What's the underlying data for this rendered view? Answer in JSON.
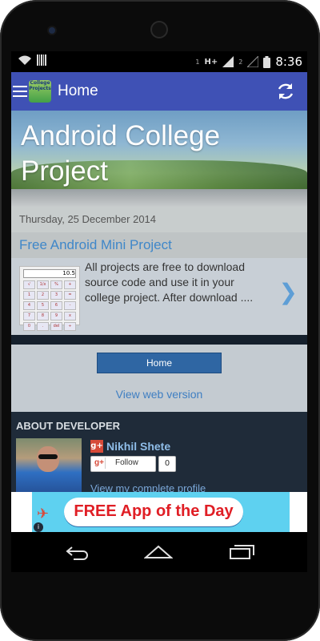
{
  "status_bar": {
    "time": "8:36",
    "signal_label_1": "H+",
    "sim_1": "1",
    "sim_2": "2",
    "icons": [
      "wifi-icon",
      "barcode-icon",
      "signal-icon",
      "signal-icon",
      "battery-icon"
    ]
  },
  "app_bar": {
    "title": "Home",
    "logo_text": "College Projects",
    "colors": {
      "background": "#3f51b5"
    }
  },
  "hero": {
    "title": "Android College Project"
  },
  "post": {
    "date": "Thursday, 25 December 2014",
    "title": "Free Android Mini Project",
    "excerpt": "All projects are free to download source code and use it in your college project. After download ....",
    "thumbnail_display": "10.5",
    "thumbnail_keys": [
      "√",
      "1/x",
      "%",
      "+",
      "1",
      "2",
      "3",
      "=",
      "4",
      "5",
      "6",
      "-",
      "7",
      "8",
      "9",
      "x",
      "0",
      ".",
      "del",
      "÷"
    ]
  },
  "navigation": {
    "home_button": "Home",
    "web_version_link": "View web version"
  },
  "about": {
    "heading": "ABOUT DEVELOPER",
    "name": "Nikhil Shete",
    "follow_label": "Follow",
    "follow_count": "0",
    "profile_link": "View my complete profile"
  },
  "ad": {
    "text": "FREE App of the Day",
    "info_symbol": "i"
  },
  "colors": {
    "accent_blue": "#3f87c9",
    "button_blue": "#2f66a3",
    "ad_red": "#e01e25",
    "gplus_red": "#d74a38"
  }
}
